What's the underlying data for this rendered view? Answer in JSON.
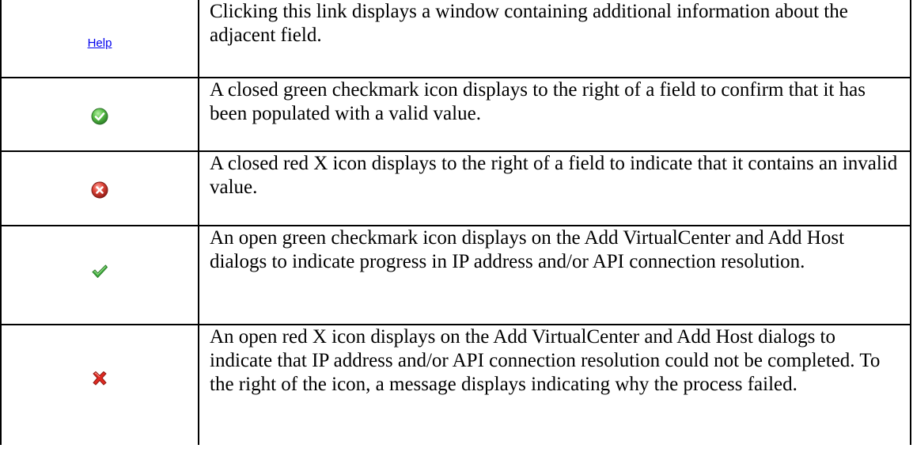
{
  "rows": [
    {
      "icon": "help-link",
      "icon_label": "Help",
      "description": "Clicking this link displays a window containing additional information about the adjacent field."
    },
    {
      "icon": "closed-green-checkmark-icon",
      "description": "A closed green checkmark icon displays to the right of a field to confirm that it has been populated with a valid value."
    },
    {
      "icon": "closed-red-x-icon",
      "description": "A closed red X icon displays to the right of a field to indicate that it contains an invalid value."
    },
    {
      "icon": "open-green-checkmark-icon",
      "description": "An open green checkmark icon displays on the Add VirtualCenter and Add Host dialogs to indicate progress in IP address and/or API connection resolution."
    },
    {
      "icon": "open-red-x-icon",
      "description": "An open red X icon displays on the Add VirtualCenter and Add Host dialogs to indicate that IP address and/or API connection resolution could not be completed. To the right of the icon, a message displays indicating why the process failed."
    }
  ],
  "colors": {
    "link": "#0000ee",
    "green": "#3fae3f",
    "red": "#d42020",
    "border": "#000000"
  }
}
